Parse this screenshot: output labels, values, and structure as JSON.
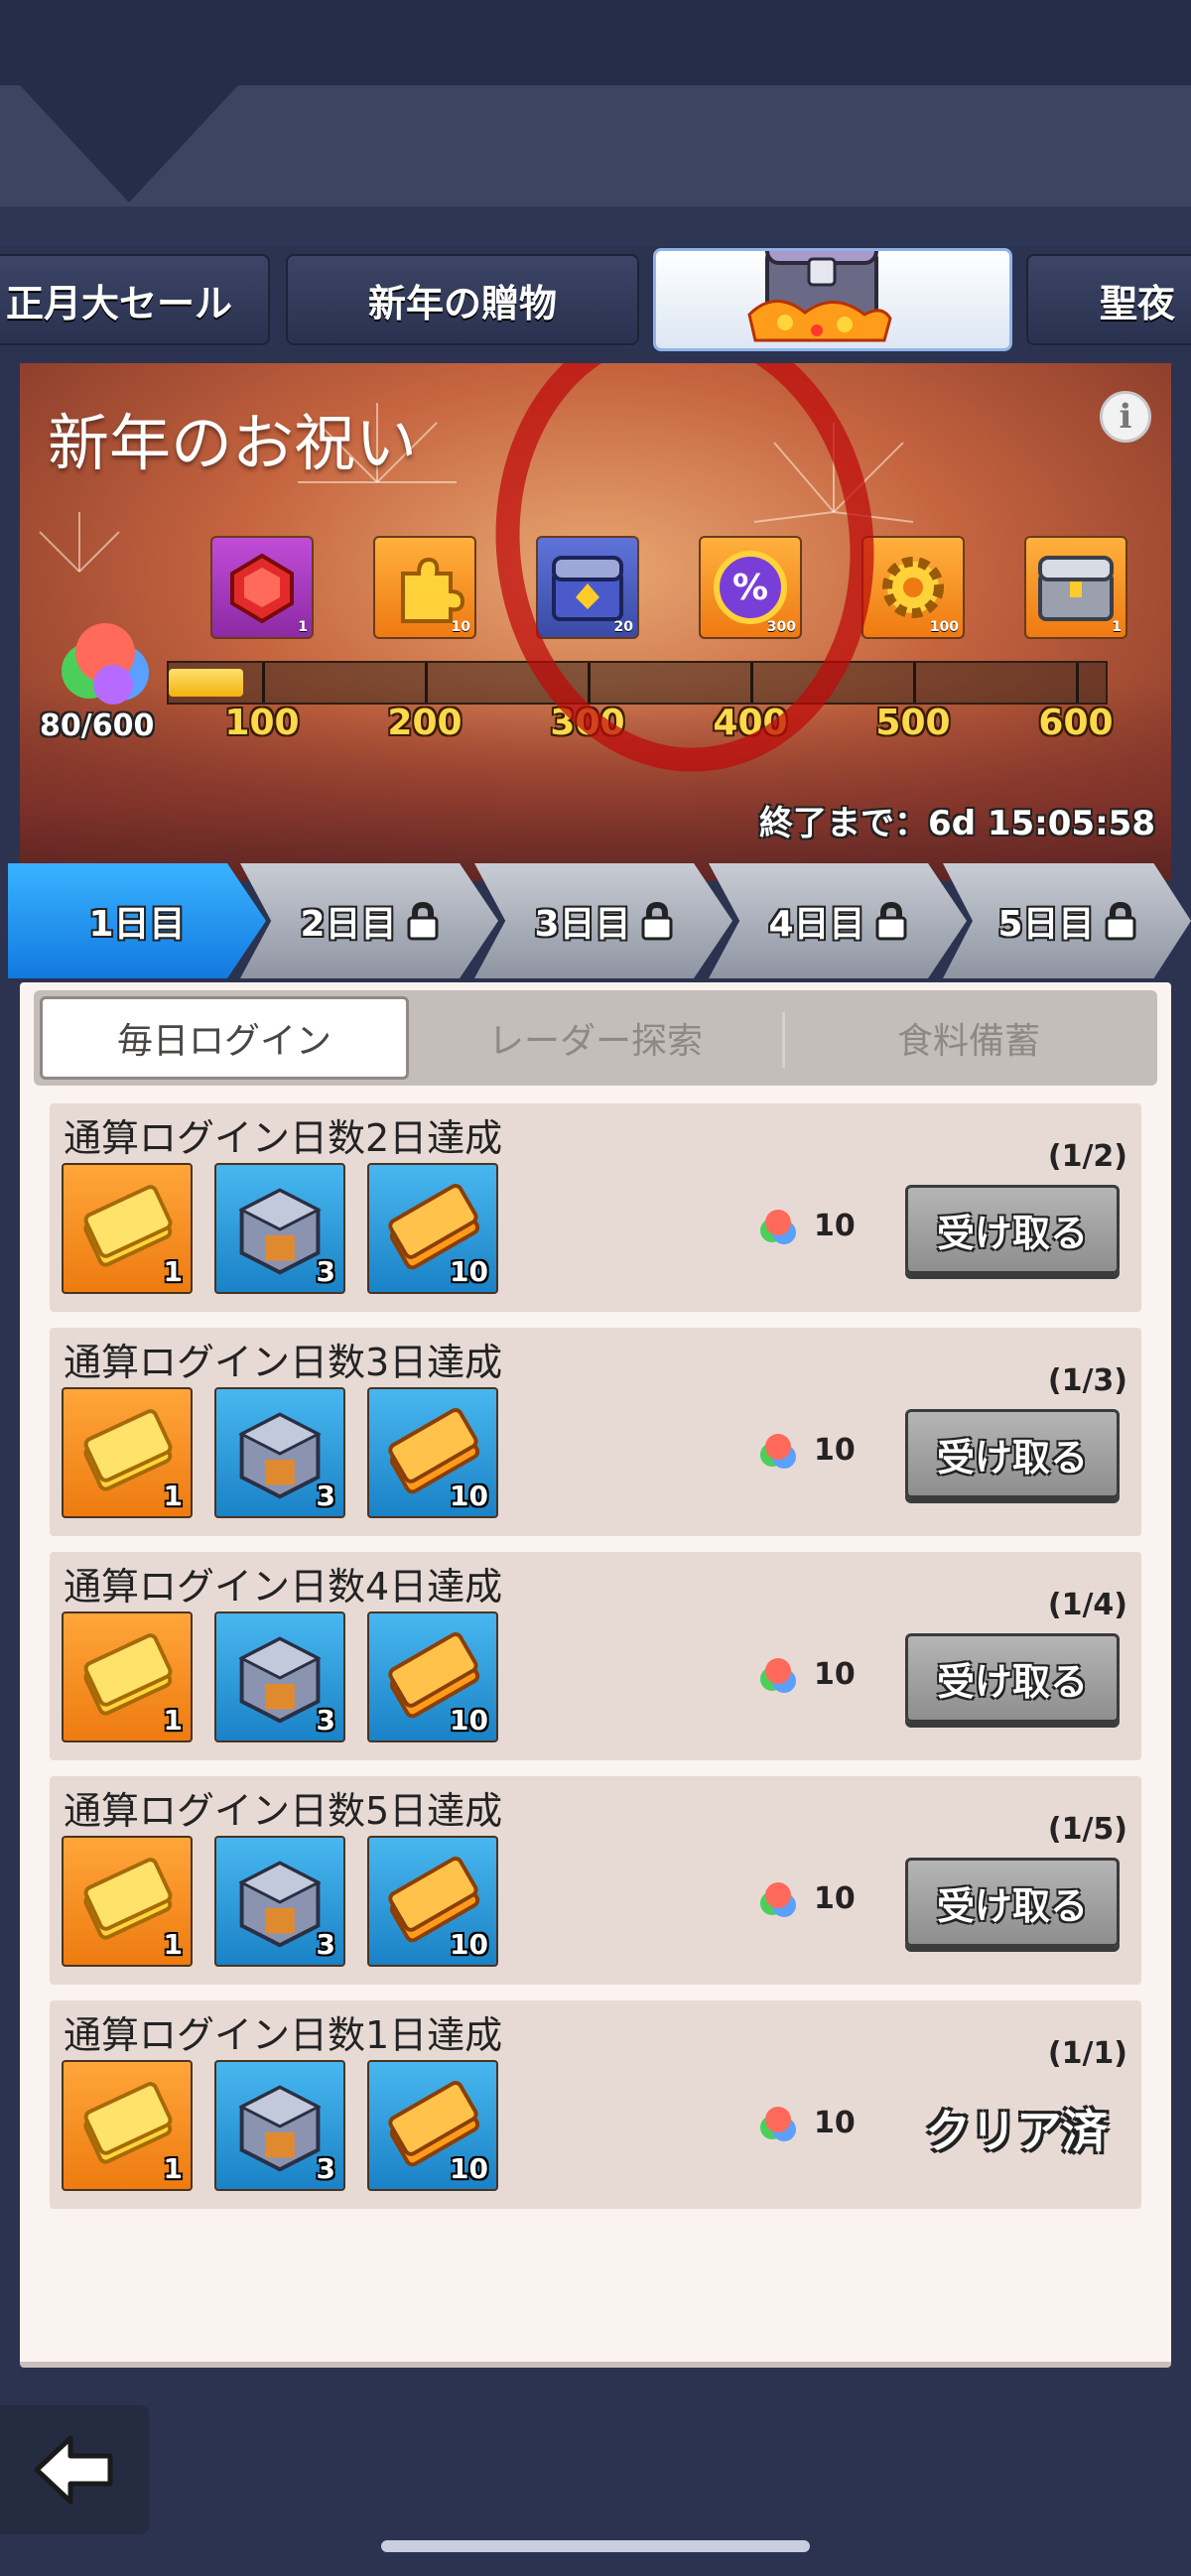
{
  "event_tabs": [
    {
      "label": "正月大セール"
    },
    {
      "label": "新年の贈物"
    },
    {
      "label": "",
      "icon": "treasure-chest-icon"
    },
    {
      "label": "聖夜"
    }
  ],
  "banner": {
    "title": "新年のお祝い",
    "progress_text": "80/600",
    "progress": {
      "current": 80,
      "max": 600
    },
    "milestones": [
      {
        "label": "100",
        "icon": "ruby-gem-icon",
        "qty": "1"
      },
      {
        "label": "200",
        "icon": "puzzle-piece-icon",
        "qty": "10"
      },
      {
        "label": "300",
        "icon": "blue-chest-icon",
        "qty": "20"
      },
      {
        "label": "400",
        "icon": "percent-coupon-icon",
        "qty": "300"
      },
      {
        "label": "500",
        "icon": "gear-icon",
        "qty": "100"
      },
      {
        "label": "600",
        "icon": "silver-chest-icon",
        "qty": "1"
      }
    ],
    "timer_text": "終了まで：6d 15:05:58"
  },
  "day_tabs": [
    {
      "label": "1日目",
      "locked": false
    },
    {
      "label": "2日目",
      "locked": true
    },
    {
      "label": "3日目",
      "locked": true
    },
    {
      "label": "4日目",
      "locked": true
    },
    {
      "label": "5日目",
      "locked": true
    }
  ],
  "sub_tabs": [
    {
      "label": "毎日ログイン"
    },
    {
      "label": "レーダー探索"
    },
    {
      "label": "食料備蓄"
    }
  ],
  "tasks": [
    {
      "title": "通算ログイン日数2日達成",
      "progress": "(1/2)",
      "rewards": [
        {
          "icon": "gold-ticket-icon",
          "qty": "1"
        },
        {
          "icon": "steel-cube-icon",
          "qty": "3"
        },
        {
          "icon": "orange-ticket-icon",
          "qty": "10"
        }
      ],
      "points": "10",
      "button": "受け取る"
    },
    {
      "title": "通算ログイン日数3日達成",
      "progress": "(1/3)",
      "rewards": [
        {
          "icon": "gold-ticket-icon",
          "qty": "1"
        },
        {
          "icon": "steel-cube-icon",
          "qty": "3"
        },
        {
          "icon": "orange-ticket-icon",
          "qty": "10"
        }
      ],
      "points": "10",
      "button": "受け取る"
    },
    {
      "title": "通算ログイン日数4日達成",
      "progress": "(1/4)",
      "rewards": [
        {
          "icon": "gold-ticket-icon",
          "qty": "1"
        },
        {
          "icon": "steel-cube-icon",
          "qty": "3"
        },
        {
          "icon": "orange-ticket-icon",
          "qty": "10"
        }
      ],
      "points": "10",
      "button": "受け取る"
    },
    {
      "title": "通算ログイン日数5日達成",
      "progress": "(1/5)",
      "rewards": [
        {
          "icon": "gold-ticket-icon",
          "qty": "1"
        },
        {
          "icon": "steel-cube-icon",
          "qty": "3"
        },
        {
          "icon": "orange-ticket-icon",
          "qty": "10"
        }
      ],
      "points": "10",
      "button": "受け取る"
    },
    {
      "title": "通算ログイン日数1日達成",
      "progress": "(1/1)",
      "rewards": [
        {
          "icon": "gold-ticket-icon",
          "qty": "1"
        },
        {
          "icon": "steel-cube-icon",
          "qty": "3"
        },
        {
          "icon": "orange-ticket-icon",
          "qty": "10"
        }
      ],
      "points": "10",
      "status": "クリア済"
    }
  ],
  "colors": {
    "active_day": "#1f8ff0",
    "milestone_label": "#ffd94a",
    "annotation": "#be0a0a"
  }
}
